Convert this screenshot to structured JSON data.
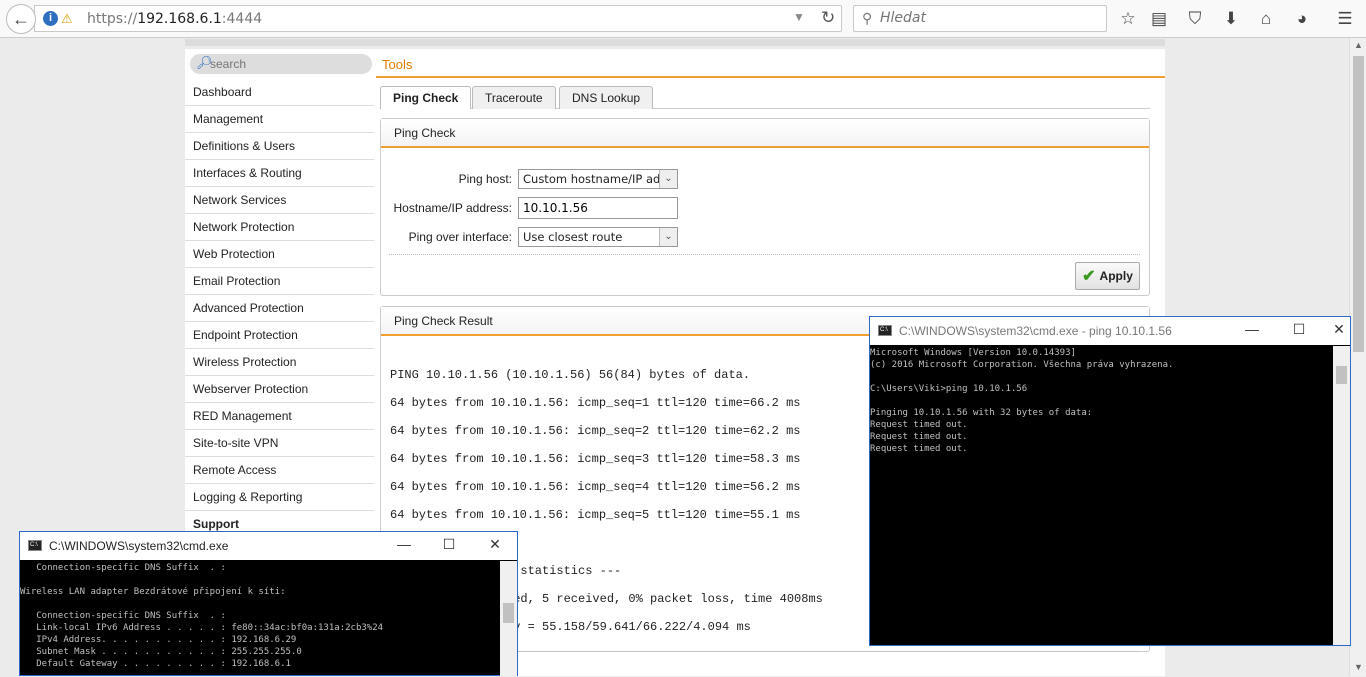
{
  "browser": {
    "url_prefix": "https://",
    "url_host": "192.168.6.1",
    "url_port": ":4444",
    "search_placeholder": "Hledat"
  },
  "sidebar": {
    "search_placeholder": "search",
    "items": [
      {
        "label": "Dashboard"
      },
      {
        "label": "Management"
      },
      {
        "label": "Definitions & Users"
      },
      {
        "label": "Interfaces & Routing"
      },
      {
        "label": "Network Services"
      },
      {
        "label": "Network Protection"
      },
      {
        "label": "Web Protection"
      },
      {
        "label": "Email Protection"
      },
      {
        "label": "Advanced Protection"
      },
      {
        "label": "Endpoint Protection"
      },
      {
        "label": "Wireless Protection"
      },
      {
        "label": "Webserver Protection"
      },
      {
        "label": "RED Management"
      },
      {
        "label": "Site-to-site VPN"
      },
      {
        "label": "Remote Access"
      },
      {
        "label": "Logging & Reporting"
      },
      {
        "label": "Support"
      }
    ]
  },
  "breadcrumb": "Tools",
  "tabs": [
    {
      "label": "Ping Check"
    },
    {
      "label": "Traceroute"
    },
    {
      "label": "DNS Lookup"
    }
  ],
  "ping_form": {
    "title": "Ping Check",
    "host_label": "Ping host:",
    "host_value": "Custom hostname/IP address",
    "address_label": "Hostname/IP address:",
    "address_value": "10.10.1.56",
    "interface_label": "Ping over interface:",
    "interface_value": "Use closest route",
    "apply_label": "Apply"
  },
  "result": {
    "title": "Ping Check Result",
    "lines": [
      "PING 10.10.1.56 (10.10.1.56) 56(84) bytes of data.",
      "64 bytes from 10.10.1.56: icmp_seq=1 ttl=120 time=66.2 ms",
      "64 bytes from 10.10.1.56: icmp_seq=2 ttl=120 time=62.2 ms",
      "64 bytes from 10.10.1.56: icmp_seq=3 ttl=120 time=58.3 ms",
      "64 bytes from 10.10.1.56: icmp_seq=4 ttl=120 time=56.2 ms",
      "64 bytes from 10.10.1.56: icmp_seq=5 ttl=120 time=55.1 ms",
      "g statistics ---",
      "ced, 5 received, 0% packet loss, time 4008ms",
      "ev = 55.158/59.641/66.222/4.094 ms"
    ]
  },
  "cmd_left": {
    "title": "C:\\WINDOWS\\system32\\cmd.exe",
    "text": "   Connection-specific DNS Suffix  . :\n\nWireless LAN adapter Bezdrátové připojení k síti:\n\n   Connection-specific DNS Suffix  . :\n   Link-local IPv6 Address . . . . . : fe80::34ac:bf0a:131a:2cb3%24\n   IPv4 Address. . . . . . . . . . . : 192.168.6.29\n   Subnet Mask . . . . . . . . . . . : 255.255.255.0\n   Default Gateway . . . . . . . . . : 192.168.6.1"
  },
  "cmd_right": {
    "title": "C:\\WINDOWS\\system32\\cmd.exe - ping  10.10.1.56",
    "text": "Microsoft Windows [Version 10.0.14393]\n(c) 2016 Microsoft Corporation. Všechna práva vyhrazena.\n\nC:\\Users\\Viki>ping 10.10.1.56\n\nPinging 10.10.1.56 with 32 bytes of data:\nRequest timed out.\nRequest timed out.\nRequest timed out."
  }
}
